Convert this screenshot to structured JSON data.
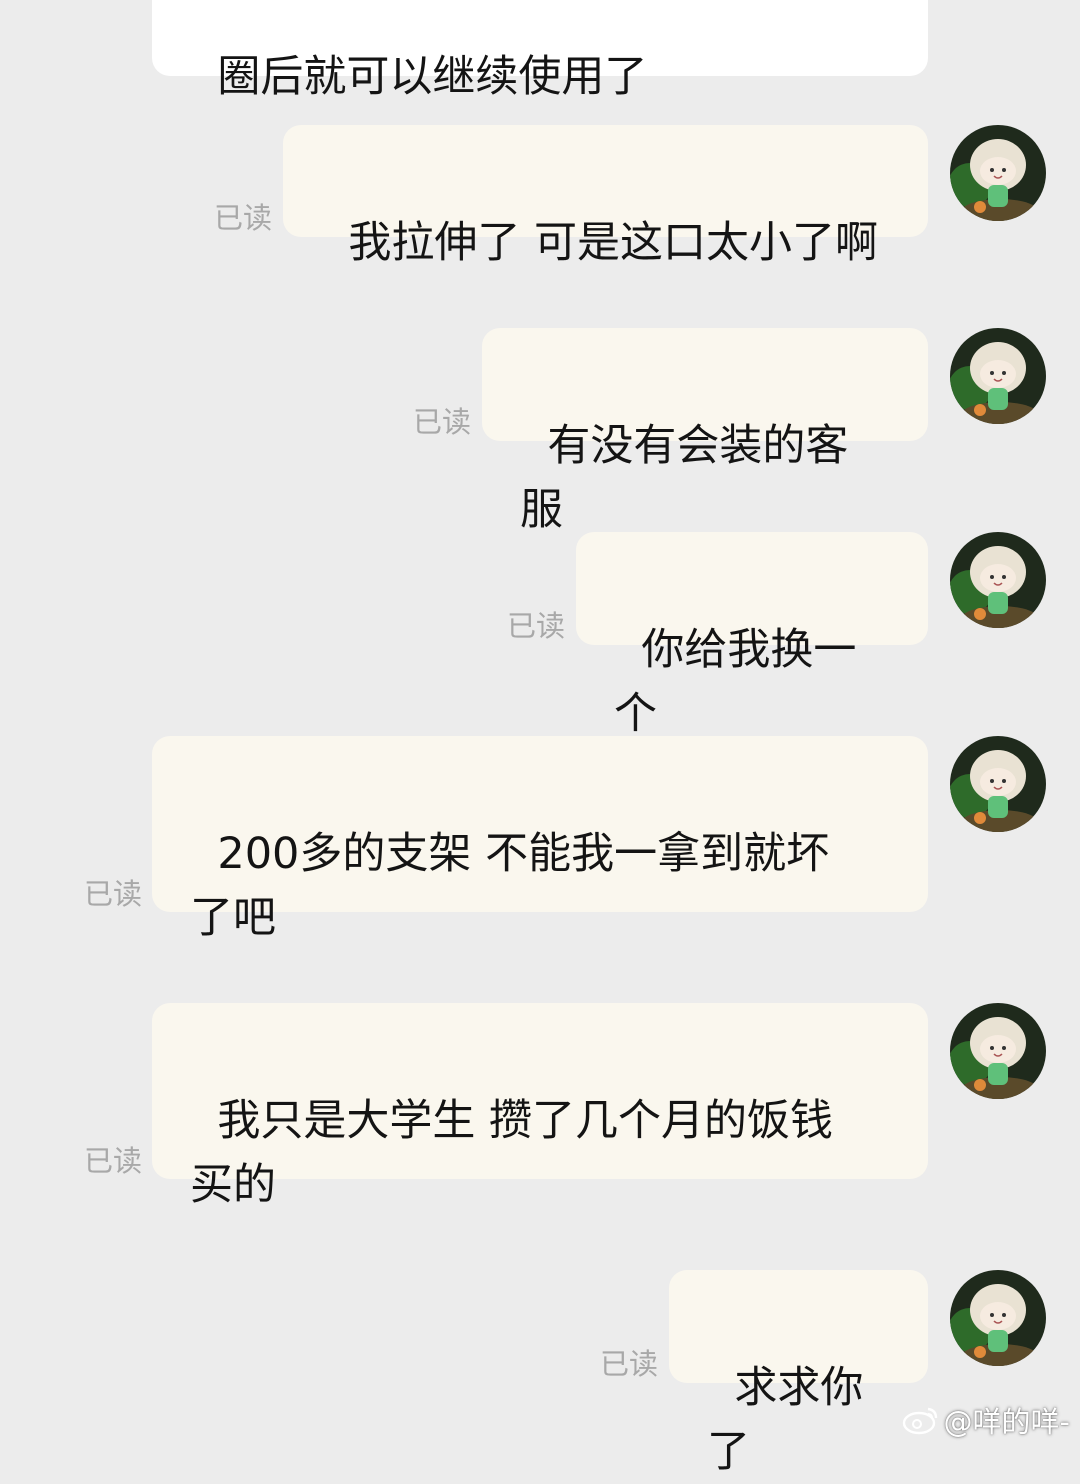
{
  "messages": [
    {
      "text": "圈后就可以继续使用了",
      "side": "incoming",
      "read_label": ""
    },
    {
      "text": "我拉伸了 可是这口太小了啊",
      "side": "outgoing",
      "read_label": "已读"
    },
    {
      "text": "有没有会装的客服",
      "side": "outgoing",
      "read_label": "已读"
    },
    {
      "text": "你给我换一个",
      "side": "outgoing",
      "read_label": "已读"
    },
    {
      "text": "200多的支架 不能我一拿到就坏\n了吧",
      "side": "outgoing",
      "read_label": "已读"
    },
    {
      "text": "我只是大学生 攒了几个月的饭钱\n买的",
      "side": "outgoing",
      "read_label": "已读"
    },
    {
      "text": "求求你了",
      "side": "outgoing",
      "read_label": "已读"
    }
  ],
  "avatar": {
    "icon": "cartoon-doll-avatar",
    "alt": ""
  },
  "watermark": {
    "icon": "weibo-logo-icon",
    "text": "@咩的咩-"
  },
  "colors": {
    "background": "#ececec",
    "incoming_bubble": "#ffffff",
    "outgoing_bubble": "#faf7ee",
    "read_label": "#a8a8a8",
    "text": "#141414"
  }
}
